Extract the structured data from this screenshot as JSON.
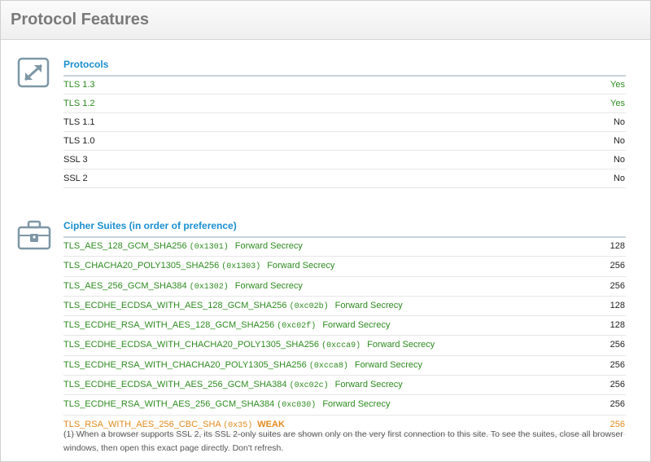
{
  "page": {
    "title": "Protocol Features"
  },
  "protocols": {
    "title": "Protocols",
    "rows": [
      {
        "name": "TLS 1.3",
        "value": "Yes",
        "color": "#2e8b20"
      },
      {
        "name": "TLS 1.2",
        "value": "Yes",
        "color": "#2e8b20"
      },
      {
        "name": "TLS 1.1",
        "value": "No",
        "color": "#222222"
      },
      {
        "name": "TLS 1.0",
        "value": "No",
        "color": "#222222"
      },
      {
        "name": "SSL 3",
        "value": "No",
        "color": "#222222"
      },
      {
        "name": "SSL 2",
        "value": "No",
        "color": "#222222"
      }
    ]
  },
  "ciphers": {
    "title": "Cipher Suites (in order of preference)",
    "rows": [
      {
        "name": "TLS_AES_128_GCM_SHA256",
        "code": "(0x1301)",
        "tag": "Forward Secrecy",
        "bits": "128"
      },
      {
        "name": "TLS_CHACHA20_POLY1305_SHA256",
        "code": "(0x1303)",
        "tag": "Forward Secrecy",
        "bits": "256"
      },
      {
        "name": "TLS_AES_256_GCM_SHA384",
        "code": "(0x1302)",
        "tag": "Forward Secrecy",
        "bits": "256"
      },
      {
        "name": "TLS_ECDHE_ECDSA_WITH_AES_128_GCM_SHA256",
        "code": "(0xc02b)",
        "tag": "Forward Secrecy",
        "bits": "128"
      },
      {
        "name": "TLS_ECDHE_RSA_WITH_AES_128_GCM_SHA256",
        "code": "(0xc02f)",
        "tag": "Forward Secrecy",
        "bits": "128"
      },
      {
        "name": "TLS_ECDHE_ECDSA_WITH_CHACHA20_POLY1305_SHA256",
        "code": "(0xcca9)",
        "tag": "Forward Secrecy",
        "bits": "256"
      },
      {
        "name": "TLS_ECDHE_RSA_WITH_CHACHA20_POLY1305_SHA256",
        "code": "(0xcca8)",
        "tag": "Forward Secrecy",
        "bits": "256"
      },
      {
        "name": "TLS_ECDHE_ECDSA_WITH_AES_256_GCM_SHA384",
        "code": "(0xc02c)",
        "tag": "Forward Secrecy",
        "bits": "256"
      },
      {
        "name": "TLS_ECDHE_RSA_WITH_AES_256_GCM_SHA384",
        "code": "(0xc030)",
        "tag": "Forward Secrecy",
        "bits": "256"
      }
    ],
    "weak_row": {
      "name": "TLS_RSA_WITH_AES_256_CBC_SHA",
      "code": "(0x35)",
      "tag": "WEAK",
      "bits": "256"
    },
    "note": "(1) When a browser supports SSL 2, its SSL 2-only suites are shown only on the very first connection to this site. To see the suites, close all browser windows, then open this exact page directly. Don't refresh."
  },
  "colors": {
    "secure": "#2e8b20",
    "weak": "#e38a1e",
    "neutral": "#222222",
    "accent": "#1a8fd0"
  },
  "icons": {
    "protocols": "expand-arrows-icon",
    "ciphers": "briefcase-lock-icon"
  }
}
